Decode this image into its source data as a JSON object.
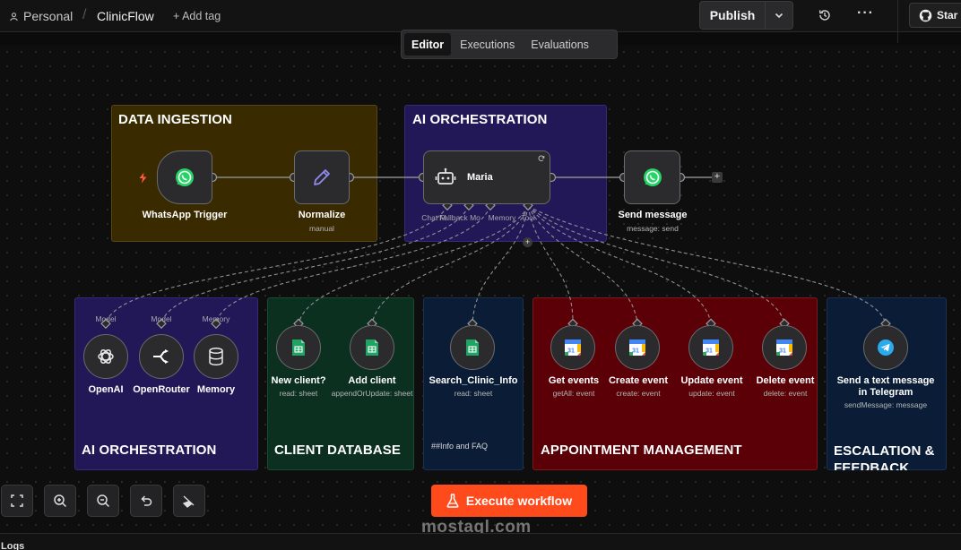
{
  "header": {
    "workspace": "Personal",
    "workflow_name": "ClinicFlow",
    "add_tag": "+ Add tag",
    "publish_label": "Publish",
    "star_label": "Star"
  },
  "tabs": [
    {
      "label": "Editor",
      "active": true
    },
    {
      "label": "Executions",
      "active": false
    },
    {
      "label": "Evaluations",
      "active": false
    }
  ],
  "groups": {
    "data_ingestion": {
      "title": "DATA INGESTION",
      "color": "#3a2a00"
    },
    "ai_orchestration_top": {
      "title": "AI ORCHESTRATION",
      "color": "#221858"
    },
    "ai_orchestration_bottom": {
      "title": "AI ORCHESTRATION",
      "color": "#221858"
    },
    "client_database": {
      "title": "CLIENT DATABASE",
      "color": "#0c3020"
    },
    "info": {
      "title": "##Info and FAQ",
      "color": "#0b1d36"
    },
    "appointment": {
      "title": "APPOINTMENT MANAGEMENT",
      "color": "#5a0006"
    },
    "escalation": {
      "title": "ESCALATION & FEEDBACK",
      "color": "#0b1d36"
    }
  },
  "nodes": {
    "whatsapp_trigger": {
      "label": "WhatsApp Trigger",
      "icon": "whatsapp-icon"
    },
    "normalize": {
      "label": "Normalize",
      "sub": "manual",
      "icon": "pencil-icon"
    },
    "maria": {
      "label": "Maria",
      "icon": "robot-icon"
    },
    "send_message": {
      "label": "Send message",
      "sub": "message: send",
      "icon": "whatsapp-icon"
    },
    "openai": {
      "label": "OpenAI",
      "port": "Model",
      "icon": "openai-icon"
    },
    "openrouter": {
      "label": "OpenRouter",
      "port": "Model",
      "icon": "openrouter-icon"
    },
    "memory": {
      "label": "Memory",
      "port": "Memory",
      "icon": "database-icon"
    },
    "new_client": {
      "label": "New client?",
      "sub": "read: sheet",
      "icon": "sheets-icon"
    },
    "add_client": {
      "label": "Add client",
      "sub": "appendOrUpdate: sheet",
      "icon": "sheets-icon"
    },
    "search_info": {
      "label": "Search_Clinic_Info",
      "sub": "read: sheet",
      "icon": "sheets-icon"
    },
    "get_events": {
      "label": "Get events",
      "sub": "getAll: event",
      "icon": "calendar-icon"
    },
    "create_event": {
      "label": "Create event",
      "sub": "create: event",
      "icon": "calendar-icon"
    },
    "update_event": {
      "label": "Update event",
      "sub": "update: event",
      "icon": "calendar-icon"
    },
    "delete_event": {
      "label": "Delete event",
      "sub": "delete: event",
      "icon": "calendar-icon"
    },
    "telegram": {
      "label1": "Send a text message",
      "label2": "in Telegram",
      "sub": "sendMessage: message",
      "icon": "telegram-icon"
    }
  },
  "agent_ports": [
    "Chat M",
    "Fallback Mo",
    "Memory",
    "Tool"
  ],
  "controls": {
    "execute_label": "Execute workflow",
    "logs_label": "Logs"
  },
  "watermark": "mostaql.com",
  "colors": {
    "accent": "#ff4a1c",
    "whatsapp": "#25d366",
    "sheets": "#1fa463",
    "calendar": "#4285f4",
    "telegram": "#2aabee"
  }
}
